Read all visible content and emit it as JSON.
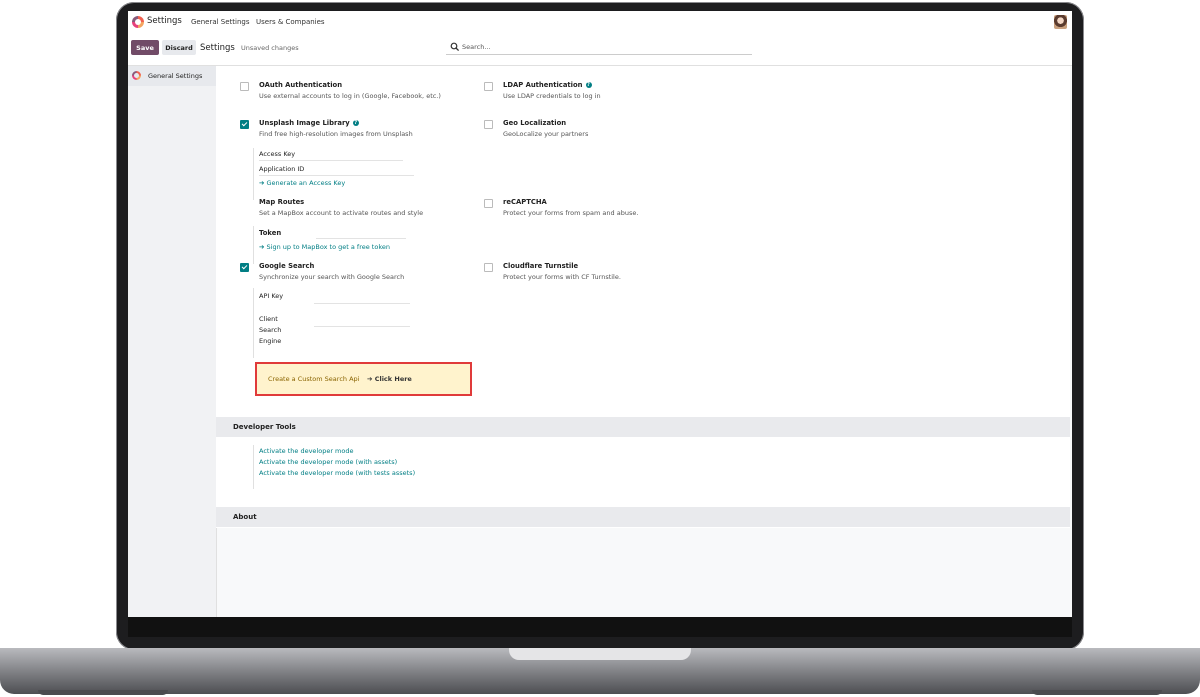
{
  "navbar": {
    "app_name": "Settings",
    "menu": [
      "General Settings",
      "Users & Companies"
    ]
  },
  "control_panel": {
    "save_label": "Save",
    "discard_label": "Discard",
    "breadcrumb": "Settings",
    "status": "Unsaved changes",
    "search_placeholder": "Search..."
  },
  "sidebar": {
    "items": [
      {
        "label": "General Settings",
        "active": true
      }
    ]
  },
  "integrations": {
    "oauth": {
      "title": "OAuth Authentication",
      "desc": "Use external accounts to log in (Google, Facebook, etc.)",
      "checked": false
    },
    "ldap": {
      "title": "LDAP Authentication",
      "desc": "Use LDAP credentials to log in",
      "checked": false,
      "help": "?"
    },
    "unsplash": {
      "title": "Unsplash Image Library",
      "desc": "Find free high-resolution images from Unsplash",
      "checked": true,
      "help": "?",
      "fields": [
        "Access Key",
        "Application ID"
      ],
      "link": "➔ Generate an Access Key"
    },
    "geo": {
      "title": "Geo Localization",
      "desc": "GeoLocalize your partners",
      "checked": false
    },
    "map_routes": {
      "title": "Map Routes",
      "desc": "Set a MapBox account to activate routes and style",
      "field": "Token",
      "link": "➔ Sign up to MapBox to get a free token"
    },
    "recaptcha": {
      "title": "reCAPTCHA",
      "desc": "Protect your forms from spam and abuse.",
      "checked": false
    },
    "google_search": {
      "title": "Google Search",
      "desc": "Synchronize your search with Google Search",
      "checked": true,
      "fields": [
        "API Key",
        "Client",
        "Search",
        "Engine"
      ],
      "custom_search_label": "Create a Custom Search Api",
      "click_here": "➔ Click Here"
    },
    "turnstile": {
      "title": "Cloudflare Turnstile",
      "desc": "Protect your forms with CF Turnstile.",
      "checked": false
    }
  },
  "developer_tools": {
    "title": "Developer Tools",
    "links": [
      "Activate the developer mode",
      "Activate the developer mode (with assets)",
      "Activate the developer mode (with tests assets)"
    ]
  },
  "about": {
    "title": "About"
  },
  "colors": {
    "brand": "#714b67",
    "accent": "#017e84",
    "highlight_border": "#e03a3a",
    "highlight_bg": "#fff3cd"
  }
}
